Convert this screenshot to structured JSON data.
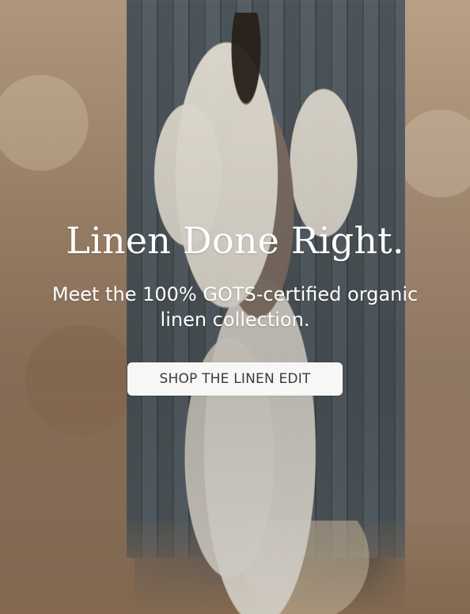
{
  "hero": {
    "headline": "Linen Done Right.",
    "subheadline": "Meet the 100% GOTS-certified organic linen collection.",
    "cta_label": "SHOP THE LINEN EDIT"
  }
}
